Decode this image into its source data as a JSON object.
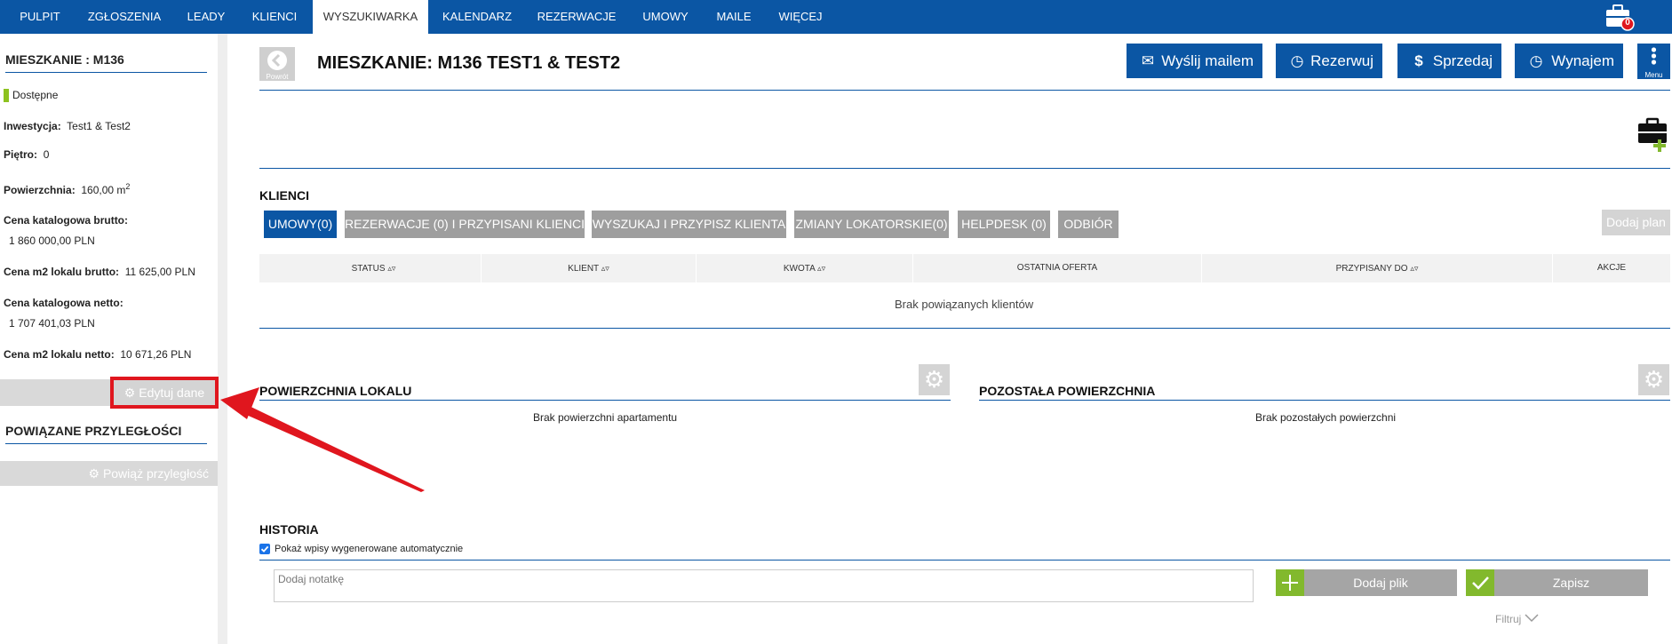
{
  "nav": {
    "items": [
      "PULPIT",
      "ZGŁOSZENIA",
      "LEADY",
      "KLIENCI",
      "WYSZUKIWARKA",
      "KALENDARZ",
      "REZERWACJE",
      "UMOWY",
      "MAILE",
      "WIĘCEJ"
    ],
    "active": "WYSZUKIWARKA",
    "notif_count": "0"
  },
  "sidebar": {
    "title": "MIESZKANIE : M136",
    "status": "Dostępne",
    "status_color": "#8dc21f",
    "investment_label": "Inwestycja:",
    "investment_value": "Test1 & Test2",
    "floor_label": "Piętro:",
    "floor_value": "0",
    "area_label": "Powierzchnia:",
    "area_value": "160,00 m",
    "area_sup": "2",
    "gross_price_label": "Cena katalogowa brutto:",
    "gross_price_value": "1 860 000,00 PLN",
    "gross_m2_label": "Cena m2 lokalu brutto:",
    "gross_m2_value": "11 625,00 PLN",
    "net_price_label": "Cena katalogowa netto:",
    "net_price_value": "1 707 401,03 PLN",
    "net_m2_label": "Cena m2 lokalu netto:",
    "net_m2_value": "10 671,26 PLN",
    "edit_button": "Edytuj dane",
    "related_title": "POWIĄZANE PRZYLEGŁOŚCI",
    "link_button": "Powiąż przyległość"
  },
  "header": {
    "back_label": "Powrót",
    "title": "MIESZKANIE: M136 TEST1 & TEST2",
    "buttons": [
      "Wyślij mailem",
      "Rezerwuj",
      "Sprzedaj",
      "Wynajem"
    ],
    "menu_label": "Menu"
  },
  "clients": {
    "title": "KLIENCI",
    "tabs": [
      "UMOWY(0)",
      "REZERWACJE (0) I PRZYPISANI KLIENCI",
      "WYSZUKAJ I PRZYPISZ KLIENTA",
      "ZMIANY LOKATORSKIE(0)",
      "HELPDESK (0)",
      "ODBIÓR"
    ],
    "add_plan": "Dodaj plan",
    "columns": [
      "STATUS",
      "KLIENT",
      "KWOTA",
      "OSTATNIA OFERTA",
      "PRZYPISANY DO",
      "AKCJE"
    ],
    "empty": "Brak powiązanych klientów"
  },
  "areas": {
    "local_title": "POWIERZCHNIA LOKALU",
    "local_empty": "Brak powierzchni apartamentu",
    "other_title": "POZOSTAŁA POWIERZCHNIA",
    "other_empty": "Brak pozostałych powierzchni"
  },
  "history": {
    "title": "HISTORIA",
    "checkbox_label": "Pokaż wpisy wygenerowane automatycznie",
    "note_placeholder": "Dodaj notatkę",
    "add_file": "Dodaj plik",
    "save": "Zapisz",
    "filter": "Filtruj"
  },
  "colors": {
    "primary": "#0b56a4",
    "accent_green": "#82b92d",
    "highlight_red": "#e0161e"
  }
}
